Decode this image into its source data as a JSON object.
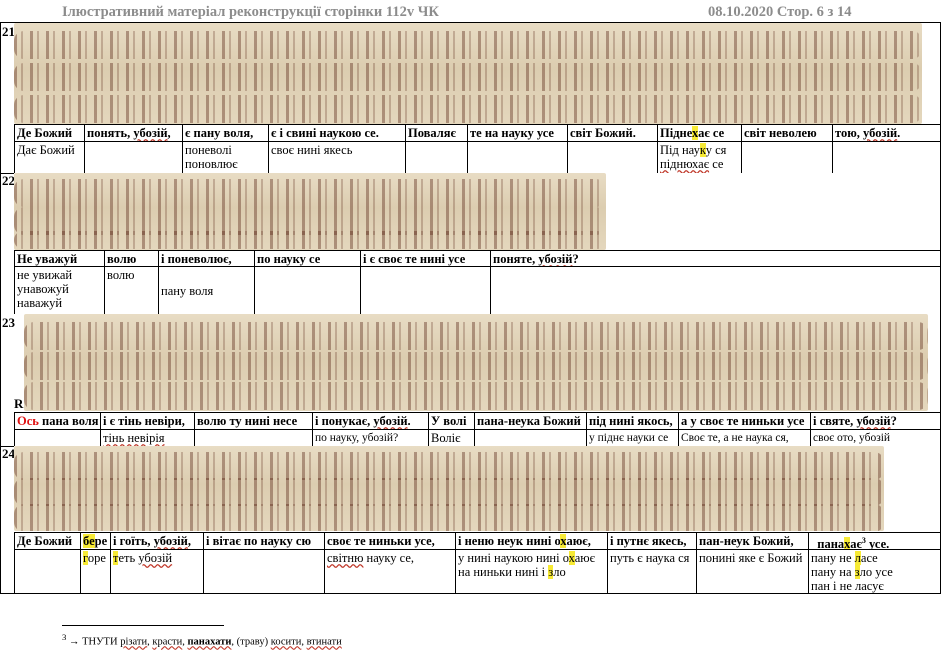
{
  "header": {
    "left": "Ілюстративний матеріал  реконструкції сторінки 112v ЧК",
    "right": "08.10.2020  Стор. 6 з 14"
  },
  "sections": [
    {
      "num": "21",
      "headers": [
        "Де Божий",
        "понять, убозій,",
        "є пану воля,",
        "є і свині наукою се.",
        "Поваляє",
        "те на науку усе",
        "світ Божий.",
        "Піднехає се",
        "світ неволею",
        "тою, убозій."
      ],
      "translations": [
        "Дає Божий",
        "",
        "поневолі поновлює",
        "своє нині якесь",
        "",
        "",
        "",
        "Під науку ся піднюхає се",
        "",
        ""
      ]
    },
    {
      "num": "22",
      "headers": [
        "Не уважуй",
        "волю",
        "і поневолює,",
        "по науку се",
        "і є своє те нині усе",
        "поняте, убозій?"
      ],
      "translations": [
        "не увижай унавожуй наважуй",
        "волю",
        "пану воля",
        "",
        "",
        ""
      ]
    },
    {
      "num": "23",
      "marker": "R",
      "headers": [
        "Ось пана воля",
        "і є тінь невіри,",
        "волю ту нині несе",
        "і понукає, убозій.",
        "У волі",
        "пана-неука Божий",
        "під нині якось,",
        "а у своє те ниньки усе",
        "і святе, убозій?"
      ],
      "translations": [
        "",
        "тінь невірія",
        "",
        "по науку, убозій?",
        "Воліє",
        "",
        "у піднє науки се",
        "Своє те, а не наука ся,",
        "своє ото, убозій"
      ]
    },
    {
      "num": "24",
      "headers": [
        "Де Божий",
        "бере",
        "і гоїть, убозій,",
        "і вітає по науку сю",
        "своє те ниньки усе,",
        "і неню неук нині охаює,",
        "і путнє якесь,",
        "пан-неук Божий,",
        "панахає³ усе."
      ],
      "translations": [
        "",
        "горе",
        "теть убозій",
        "",
        "світню науку се,",
        "у нині наукою нині охаює на ниньки нині і зло",
        "путь є наука ся",
        "понині яке є Божий",
        "пану не ласе пану на зло усе пан і не ласує"
      ]
    }
  ],
  "footnote": "³ → ТНУТИ різати, красти, панахати, (траву) косити, втинати"
}
